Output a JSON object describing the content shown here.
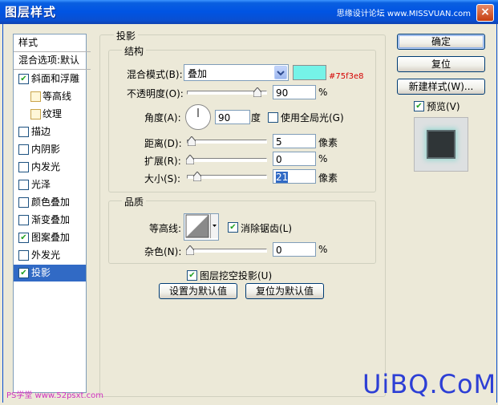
{
  "window": {
    "title": "图层样式",
    "top_watermark": "思缘设计论坛 www.MISSVUAN.com",
    "close_glyph": "×"
  },
  "sidebar": {
    "header": "样式",
    "blend_options": "混合选项:默认",
    "items": [
      {
        "label": "斜面和浮雕",
        "checked": true
      },
      {
        "label": "等高线",
        "checked": false,
        "sub": true
      },
      {
        "label": "纹理",
        "checked": false,
        "sub": true
      },
      {
        "label": "描边",
        "checked": false
      },
      {
        "label": "内阴影",
        "checked": false
      },
      {
        "label": "内发光",
        "checked": false
      },
      {
        "label": "光泽",
        "checked": false
      },
      {
        "label": "颜色叠加",
        "checked": false
      },
      {
        "label": "渐变叠加",
        "checked": false
      },
      {
        "label": "图案叠加",
        "checked": true
      },
      {
        "label": "外发光",
        "checked": false
      },
      {
        "label": "投影",
        "checked": true,
        "selected": true
      }
    ]
  },
  "panel": {
    "title": "投影",
    "structure": {
      "title": "结构",
      "blend_mode_label": "混合模式(B):",
      "blend_mode_value": "叠加",
      "color_hex": "#75f3e8",
      "opacity_label": "不透明度(O):",
      "opacity_value": "90",
      "opacity_unit": "%",
      "opacity_level": 0.9,
      "angle_label": "角度(A):",
      "angle_value": "90",
      "angle_unit": "度",
      "global_light_label": "使用全局光(G)",
      "global_light_checked": false,
      "distance_label": "距离(D):",
      "distance_value": "5",
      "distance_unit": "像素",
      "spread_label": "扩展(R):",
      "spread_value": "0",
      "spread_unit": "%",
      "size_label": "大小(S):",
      "size_value": "21",
      "size_unit": "像素"
    },
    "quality": {
      "title": "品质",
      "contour_label": "等高线:",
      "anti_alias_label": "消除锯齿(L)",
      "anti_alias_checked": true,
      "noise_label": "杂色(N):",
      "noise_value": "0",
      "noise_unit": "%"
    },
    "knockout_label": "图层挖空投影(U)",
    "knockout_checked": true,
    "set_default": "设置为默认值",
    "reset_default": "复位为默认值"
  },
  "buttons": {
    "ok": "确定",
    "reset": "复位",
    "new_style": "新建样式(W)...",
    "preview_label": "预览(V)",
    "preview_checked": true
  },
  "watermarks": {
    "bottom_left": "PS学堂 www.52psxt.com",
    "bottom_right": "UiBQ.CoM"
  },
  "colors": {
    "accent": "#316ac5",
    "titlebar": "#0054e3",
    "shadow_color": "#75f3e8"
  }
}
